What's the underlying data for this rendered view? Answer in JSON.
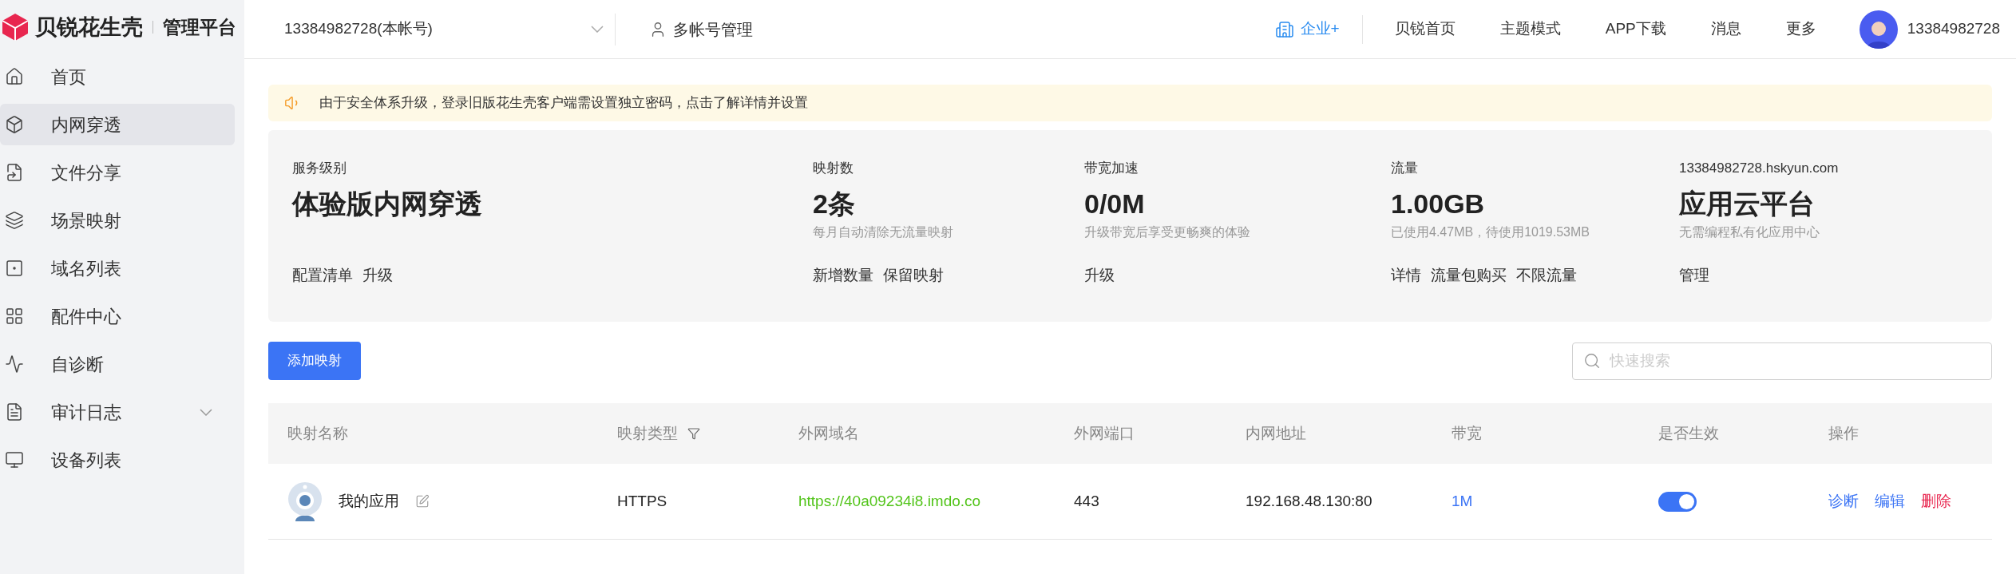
{
  "brand": {
    "name": "贝锐花生壳",
    "platform": "管理平台"
  },
  "sidebar": {
    "items": [
      {
        "label": "首页",
        "selected": false
      },
      {
        "label": "内网穿透",
        "selected": true
      },
      {
        "label": "文件分享",
        "selected": false
      },
      {
        "label": "场景映射",
        "selected": false
      },
      {
        "label": "域名列表",
        "selected": false
      },
      {
        "label": "配件中心",
        "selected": false
      },
      {
        "label": "自诊断",
        "selected": false
      },
      {
        "label": "审计日志",
        "selected": false,
        "expanded": false
      },
      {
        "label": "设备列表",
        "selected": false
      }
    ]
  },
  "header": {
    "account": "13384982728(本帐号)",
    "multi_account": "多帐号管理",
    "enterprise": "企业+",
    "nav": [
      "贝锐首页",
      "主题模式",
      "APP下载",
      "消息",
      "更多"
    ],
    "user": "13384982728"
  },
  "notice": "由于安全体系升级，登录旧版花生壳客户端需设置独立密码，点击了解详情并设置",
  "stats": [
    {
      "label": "服务级别",
      "value": "体验版内网穿透",
      "links": [
        "配置清单",
        "升级"
      ]
    },
    {
      "label": "映射数",
      "value": "2条",
      "note": "每月自动清除无流量映射",
      "links": [
        "新增数量",
        "保留映射"
      ]
    },
    {
      "label": "带宽加速",
      "value": "0/0M",
      "note": "升级带宽后享受更畅爽的体验",
      "links": [
        "升级"
      ]
    },
    {
      "label": "流量",
      "value": "1.00GB",
      "note": "已使用4.47MB，待使用1019.53MB",
      "links": [
        "详情",
        "流量包购买",
        "不限流量"
      ]
    },
    {
      "label": "13384982728.hskyun.com",
      "value": "应用云平台",
      "note": "无需编程私有化应用中心",
      "links": [
        "管理"
      ]
    }
  ],
  "add_button": "添加映射",
  "search": {
    "placeholder": "快速搜索"
  },
  "table": {
    "columns": [
      {
        "label": "映射名称"
      },
      {
        "label": "映射类型"
      },
      {
        "label": "外网域名"
      },
      {
        "label": "外网端口"
      },
      {
        "label": "内网地址"
      },
      {
        "label": "带宽"
      },
      {
        "label": "是否生效"
      },
      {
        "label": "操作"
      }
    ],
    "rows": [
      {
        "name": "我的应用",
        "type": "HTTPS",
        "domain": "https://40a09234i8.imdo.co",
        "port": "443",
        "address": "192.168.48.130:80",
        "bandwidth": "1M",
        "on": true,
        "actions": [
          {
            "label": "诊断",
            "kind": "normal"
          },
          {
            "label": "编辑",
            "kind": "normal"
          },
          {
            "label": "删除",
            "kind": "danger"
          }
        ]
      }
    ]
  }
}
